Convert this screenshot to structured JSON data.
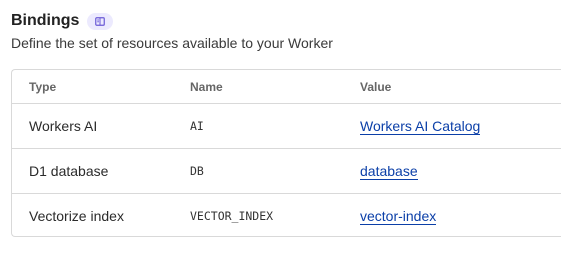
{
  "section": {
    "title": "Bindings",
    "badge_icon": "book-icon",
    "description": "Define the set of resources available to your Worker"
  },
  "table": {
    "columns": [
      "Type",
      "Name",
      "Value"
    ],
    "rows": [
      {
        "type": "Workers AI",
        "name": "AI",
        "value": "Workers AI Catalog"
      },
      {
        "type": "D1 database",
        "name": "DB",
        "value": "database"
      },
      {
        "type": "Vectorize index",
        "name": "VECTOR_INDEX",
        "value": "vector-index"
      }
    ]
  },
  "colors": {
    "badge_bg": "#eceafe",
    "badge_icon": "#6b5bd6",
    "link": "#0b3fa8",
    "border": "#d9d9d9"
  }
}
